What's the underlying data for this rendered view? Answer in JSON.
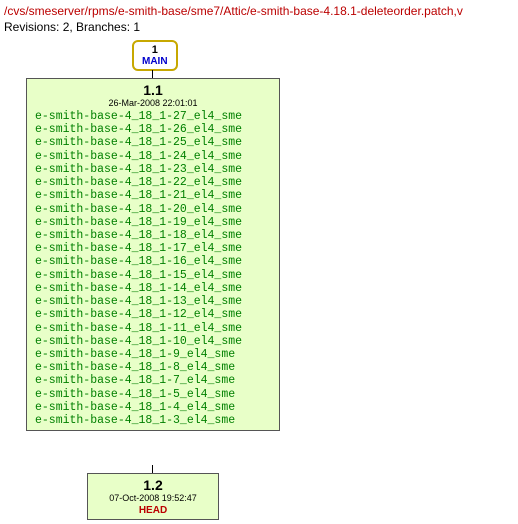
{
  "header": {
    "path": "/cvs/smeserver/rpms/e-smith-base/sme7/Attic/e-smith-base-4.18.1-deleteorder.patch,v",
    "revisions": "Revisions: 2, Branches: 1"
  },
  "branch": {
    "number": "1",
    "name": "MAIN"
  },
  "rev1": {
    "number": "1.1",
    "date": "26-Mar-2008 22:01:01",
    "tags": [
      "e-smith-base-4_18_1-27_el4_sme",
      "e-smith-base-4_18_1-26_el4_sme",
      "e-smith-base-4_18_1-25_el4_sme",
      "e-smith-base-4_18_1-24_el4_sme",
      "e-smith-base-4_18_1-23_el4_sme",
      "e-smith-base-4_18_1-22_el4_sme",
      "e-smith-base-4_18_1-21_el4_sme",
      "e-smith-base-4_18_1-20_el4_sme",
      "e-smith-base-4_18_1-19_el4_sme",
      "e-smith-base-4_18_1-18_el4_sme",
      "e-smith-base-4_18_1-17_el4_sme",
      "e-smith-base-4_18_1-16_el4_sme",
      "e-smith-base-4_18_1-15_el4_sme",
      "e-smith-base-4_18_1-14_el4_sme",
      "e-smith-base-4_18_1-13_el4_sme",
      "e-smith-base-4_18_1-12_el4_sme",
      "e-smith-base-4_18_1-11_el4_sme",
      "e-smith-base-4_18_1-10_el4_sme",
      "e-smith-base-4_18_1-9_el4_sme",
      "e-smith-base-4_18_1-8_el4_sme",
      "e-smith-base-4_18_1-7_el4_sme",
      "e-smith-base-4_18_1-5_el4_sme",
      "e-smith-base-4_18_1-4_el4_sme",
      "e-smith-base-4_18_1-3_el4_sme"
    ]
  },
  "rev2": {
    "number": "1.2",
    "date": "07-Oct-2008 19:52:47",
    "head": "HEAD"
  }
}
